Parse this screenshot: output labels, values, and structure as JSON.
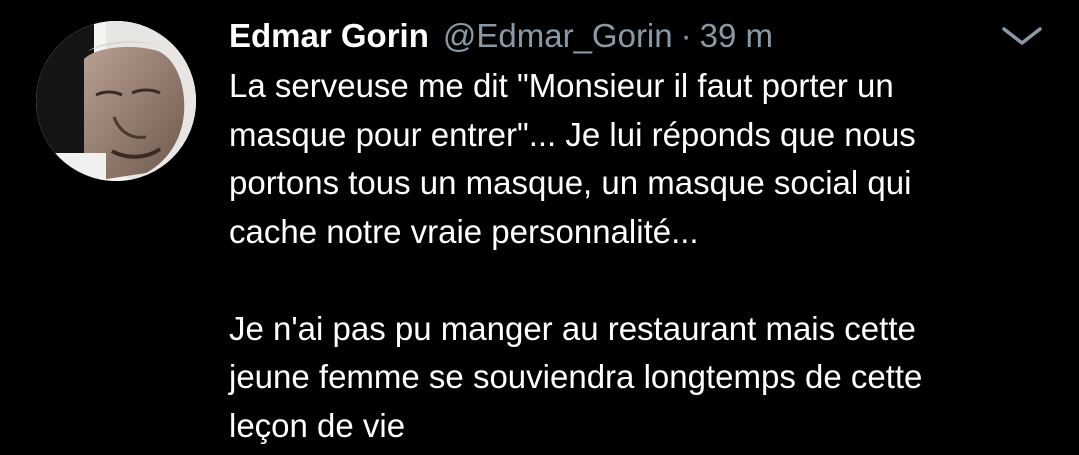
{
  "tweet": {
    "author": {
      "display_name": "Edmar Gorin",
      "handle": "@Edmar_Gorin",
      "avatar_icon": "profile-photo"
    },
    "separator": "·",
    "timestamp": "39 m",
    "menu_icon": "chevron-down-icon",
    "text": {
      "paragraph_1": "La serveuse me dit \"Monsieur il faut porter un\nmasque pour entrer\"... Je lui réponds que nous\nportons tous un masque, un masque social qui\ncache notre vraie personnalité...",
      "paragraph_2": "Je n'ai pas pu manger au restaurant mais cette\njeune femme se souviendra longtemps de cette\nleçon de vie"
    }
  },
  "colors": {
    "background": "#000000",
    "primary_text": "#ffffff",
    "secondary_text": "#8b98a5"
  }
}
